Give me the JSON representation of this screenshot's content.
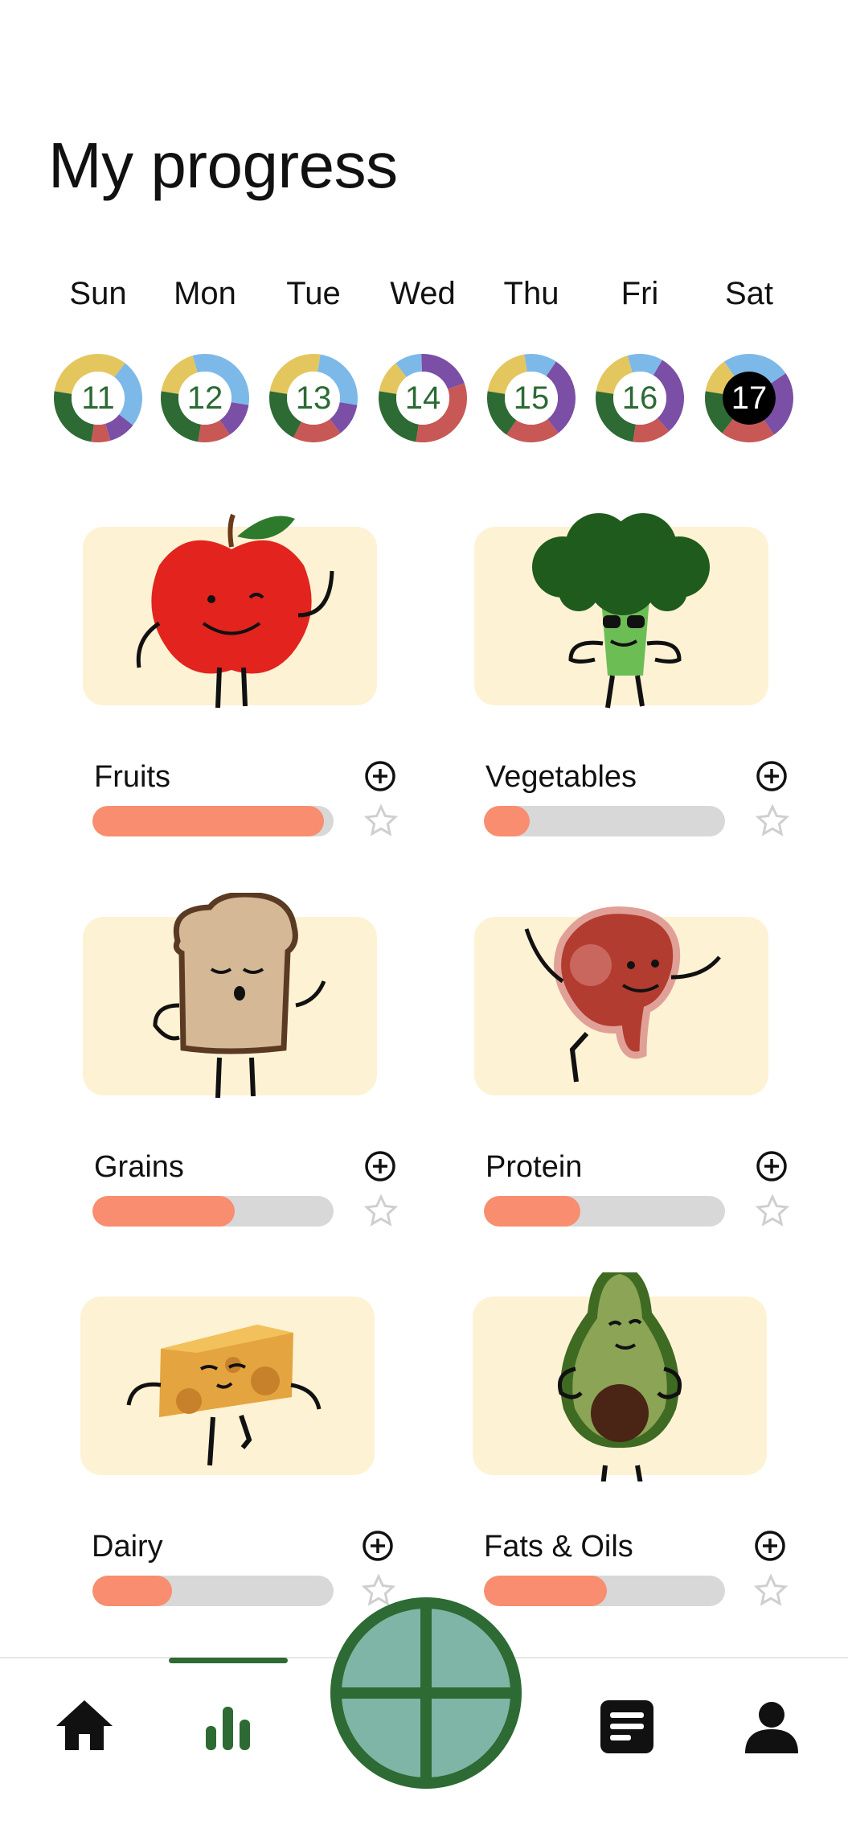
{
  "page": {
    "title": "My progress"
  },
  "week": [
    {
      "day": "Sun",
      "date": "11",
      "selected": false,
      "segments": [
        [
          "#e4c65e",
          0.33
        ],
        [
          "#7db9e8",
          0.25
        ],
        [
          "#7a4fa5",
          0.1
        ],
        [
          "#c85856",
          0.07
        ],
        [
          "#2d6a34",
          0.25
        ]
      ]
    },
    {
      "day": "Mon",
      "date": "12",
      "selected": false,
      "segments": [
        [
          "#e4c65e",
          0.18
        ],
        [
          "#7db9e8",
          0.32
        ],
        [
          "#7a4fa5",
          0.13
        ],
        [
          "#c85856",
          0.12
        ],
        [
          "#2d6a34",
          0.25
        ]
      ]
    },
    {
      "day": "Tue",
      "date": "13",
      "selected": false,
      "segments": [
        [
          "#e4c65e",
          0.25
        ],
        [
          "#7db9e8",
          0.25
        ],
        [
          "#7a4fa5",
          0.12
        ],
        [
          "#c85856",
          0.18
        ],
        [
          "#2d6a34",
          0.2
        ]
      ]
    },
    {
      "day": "Wed",
      "date": "14",
      "selected": false,
      "segments": [
        [
          "#e4c65e",
          0.12
        ],
        [
          "#7db9e8",
          0.1
        ],
        [
          "#7a4fa5",
          0.2
        ],
        [
          "#c85856",
          0.33
        ],
        [
          "#2d6a34",
          0.25
        ]
      ]
    },
    {
      "day": "Thu",
      "date": "15",
      "selected": false,
      "segments": [
        [
          "#e4c65e",
          0.2
        ],
        [
          "#7db9e8",
          0.12
        ],
        [
          "#7a4fa5",
          0.3
        ],
        [
          "#c85856",
          0.2
        ],
        [
          "#2d6a34",
          0.18
        ]
      ]
    },
    {
      "day": "Fri",
      "date": "16",
      "selected": false,
      "segments": [
        [
          "#e4c65e",
          0.18
        ],
        [
          "#7db9e8",
          0.13
        ],
        [
          "#7a4fa5",
          0.3
        ],
        [
          "#c85856",
          0.14
        ],
        [
          "#2d6a34",
          0.25
        ]
      ]
    },
    {
      "day": "Sat",
      "date": "17",
      "selected": true,
      "segments": [
        [
          "#e4c65e",
          0.13
        ],
        [
          "#7db9e8",
          0.25
        ],
        [
          "#7a4fa5",
          0.25
        ],
        [
          "#c85856",
          0.2
        ],
        [
          "#2d6a34",
          0.17
        ]
      ]
    }
  ],
  "categories": [
    {
      "name": "Fruits",
      "progress": 0.96,
      "icon": "apple-character"
    },
    {
      "name": "Vegetables",
      "progress": 0.19,
      "icon": "broccoli-character"
    },
    {
      "name": "Grains",
      "progress": 0.59,
      "icon": "toast-character"
    },
    {
      "name": "Protein",
      "progress": 0.4,
      "icon": "steak-character"
    },
    {
      "name": "Dairy",
      "progress": 0.33,
      "icon": "cheese-character"
    },
    {
      "name": "Fats & Oils",
      "progress": 0.51,
      "icon": "avocado-character"
    }
  ],
  "colors": {
    "accent": "#2d6a34",
    "bar_fill": "#f98d6f",
    "bar_track": "#d8d8d8",
    "card_bg": "#fdf2d4",
    "center_button": "#7fb5a6"
  },
  "navbar": {
    "items": [
      "home-icon",
      "chart-icon",
      "plate-icon",
      "journal-icon",
      "profile-icon"
    ],
    "active": "chart-icon"
  }
}
